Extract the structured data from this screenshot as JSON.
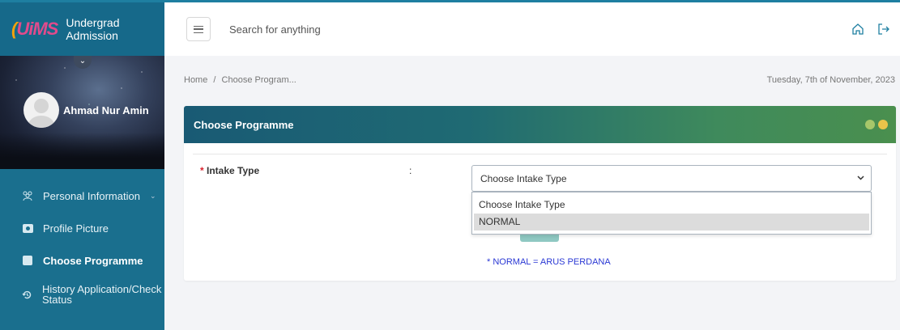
{
  "app": {
    "logo_text": "UiMS",
    "title": "Undergrad Admission"
  },
  "sidebar": {
    "user_name": "Ahmad Nur Amin",
    "items": [
      {
        "label": "Personal Information",
        "icon": "people-icon",
        "has_submenu": true
      },
      {
        "label": "Profile Picture",
        "icon": "camera-icon"
      },
      {
        "label": "Choose Programme",
        "icon": "square-icon",
        "active": true
      },
      {
        "label": "History Application/Check Status",
        "icon": "history-icon"
      }
    ]
  },
  "topbar": {
    "search_placeholder": "Search for anything"
  },
  "breadcrumb": {
    "home": "Home",
    "separator": "/",
    "current": "Choose Program..."
  },
  "date_text": "Tuesday, 7th of November, 2023",
  "card": {
    "title": "Choose Programme",
    "field_required_mark": "*",
    "field_label": "Intake Type",
    "colon": ":",
    "select_value": "Choose Intake Type",
    "options": [
      "Choose Intake Type",
      "NORMAL"
    ],
    "highlighted_option": "NORMAL",
    "note": "* NORMAL = ARUS PERDANA"
  },
  "colors": {
    "sidebar": "#1a6f8e",
    "header_gradient_start": "#195a74",
    "header_gradient_end": "#4a8f4e",
    "dot_left": "#a7c76a",
    "dot_right": "#e8c44a",
    "note": "#2a38d4",
    "required": "#d9232e"
  }
}
